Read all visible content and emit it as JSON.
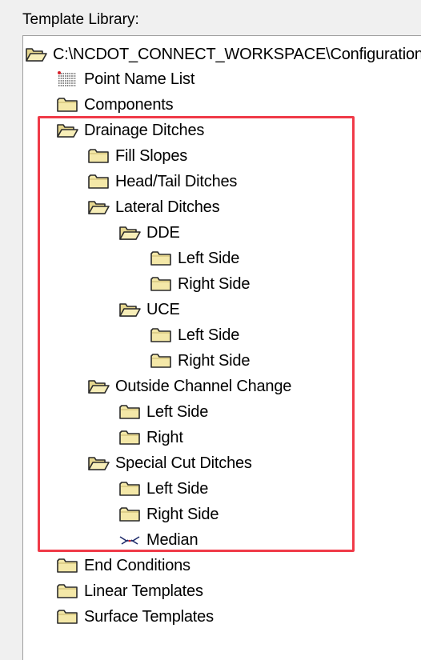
{
  "panel_title": "Template Library:",
  "colors": {
    "highlight": "#f03a48",
    "folder_fill": "#f4e8a8",
    "folder_stroke": "#2a2a2a"
  },
  "tree": {
    "root": {
      "label": "C:\\NCDOT_CONNECT_WORKSPACE\\Configuration",
      "icon": "folder-open-icon"
    },
    "point_name_list": {
      "label": "Point Name List",
      "icon": "point-list-icon"
    },
    "components": {
      "label": "Components",
      "icon": "folder-icon"
    },
    "drainage_ditches": {
      "label": "Drainage Ditches",
      "icon": "folder-open-icon",
      "fill_slopes": {
        "label": "Fill Slopes"
      },
      "head_tail_ditches": {
        "label": "Head/Tail Ditches"
      },
      "lateral_ditches": {
        "label": "Lateral Ditches",
        "dde": {
          "label": "DDE",
          "left": "Left Side",
          "right": "Right Side"
        },
        "uce": {
          "label": "UCE",
          "left": "Left Side",
          "right": "Right Side"
        }
      },
      "outside_channel_change": {
        "label": "Outside Channel Change",
        "left": "Left Side",
        "right": "Right"
      },
      "special_cut_ditches": {
        "label": "Special Cut Ditches",
        "left": "Left Side",
        "right": "Right Side"
      },
      "median": {
        "label": "Median",
        "icon": "template-icon"
      }
    },
    "end_conditions": {
      "label": "End Conditions"
    },
    "linear_templates": {
      "label": "Linear Templates"
    },
    "surface_templates": {
      "label": "Surface Templates"
    }
  }
}
